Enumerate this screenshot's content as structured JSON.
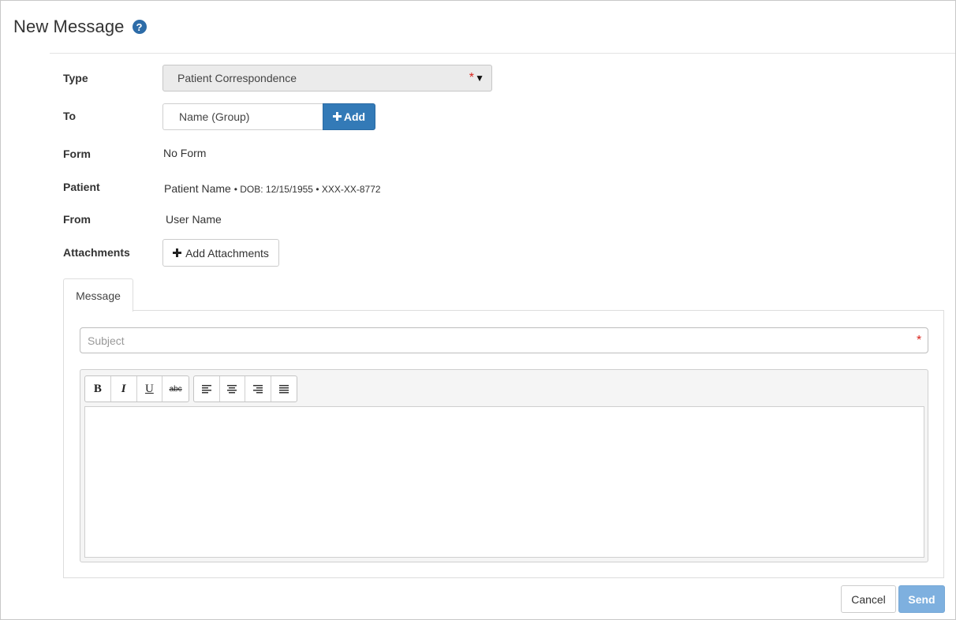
{
  "header": {
    "title": "New Message",
    "help_icon": "?"
  },
  "form": {
    "type": {
      "label": "Type",
      "value": "Patient Correspondence",
      "required_marker": "*",
      "caret": "▼"
    },
    "to": {
      "label": "To",
      "placeholder": "Name (Group)",
      "add_label": "Add"
    },
    "form_field": {
      "label": "Form",
      "value": "No Form"
    },
    "patient": {
      "label": "Patient",
      "name": "Patient Name",
      "details": "• DOB: 12/15/1955 • XXX-XX-8772"
    },
    "from": {
      "label": "From",
      "value": "User Name"
    },
    "attachments": {
      "label": "Attachments",
      "button_label": "Add Attachments"
    }
  },
  "tabs": [
    {
      "label": "Message",
      "active": true
    }
  ],
  "message": {
    "subject_placeholder": "Subject",
    "subject_required_marker": "*",
    "toolbar": {
      "format": [
        "B",
        "I",
        "U",
        "abc"
      ],
      "align": [
        "align-left-icon",
        "align-center-icon",
        "align-right-icon",
        "align-justify-icon"
      ]
    },
    "body": ""
  },
  "footer": {
    "cancel_label": "Cancel",
    "send_label": "Send"
  },
  "colors": {
    "primary": "#337ab7",
    "send_disabled": "#7eb0df",
    "required": "#d9231c",
    "help": "#2d6ca8"
  }
}
